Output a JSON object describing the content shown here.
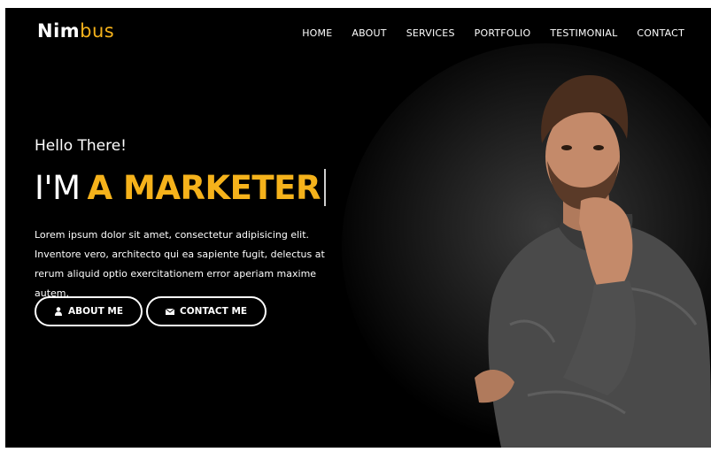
{
  "brand": {
    "name_part1": "Nim",
    "name_part2": "bus"
  },
  "nav": {
    "items": [
      "HOME",
      "ABOUT",
      "SERVICES",
      "PORTFOLIO",
      "TESTIMONIAL",
      "CONTACT"
    ]
  },
  "hero": {
    "greeting": "Hello There!",
    "headline_prefix": "I'M",
    "headline_highlight": "A MARKETER",
    "body": "Lorem ipsum dolor sit amet, consectetur adipisicing elit. Inventore vero, architecto qui ea sapiente fugit, delectus at rerum aliquid optio exercitationem error aperiam maxime autem.",
    "about_button": "ABOUT ME",
    "contact_button": "CONTACT ME"
  },
  "icons": {
    "about": "user-icon",
    "contact": "envelope-icon"
  },
  "colors": {
    "accent": "#f5b21b",
    "background": "#000000"
  }
}
